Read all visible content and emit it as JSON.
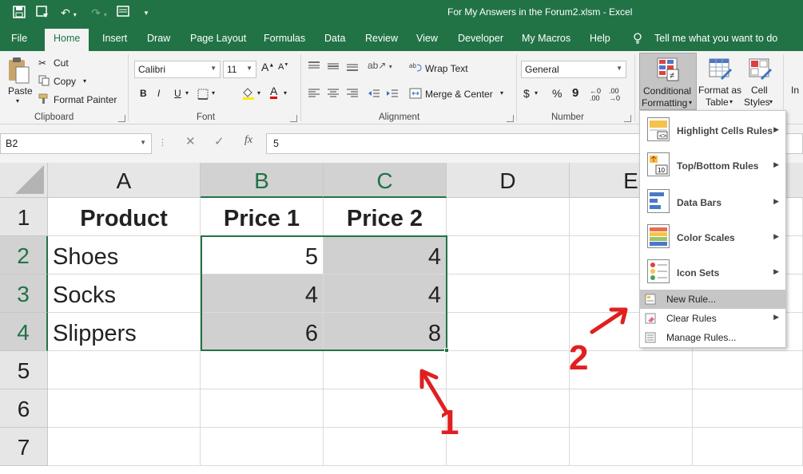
{
  "window": {
    "title": "For My Answers in the Forum2.xlsm  -  Excel"
  },
  "quick_access": {
    "save_icon": "save-icon",
    "autosave_icon": "autosave-icon",
    "undo_icon": "undo-icon",
    "redo_icon": "redo-icon",
    "form_icon": "form-icon",
    "customize_icon": "customize-icon"
  },
  "tabs": [
    {
      "label": "File"
    },
    {
      "label": "Home"
    },
    {
      "label": "Insert"
    },
    {
      "label": "Draw"
    },
    {
      "label": "Page Layout"
    },
    {
      "label": "Formulas"
    },
    {
      "label": "Data"
    },
    {
      "label": "Review"
    },
    {
      "label": "View"
    },
    {
      "label": "Developer"
    },
    {
      "label": "My Macros"
    },
    {
      "label": "Help"
    }
  ],
  "tell_me": "Tell me what you want to do",
  "ribbon": {
    "clipboard": {
      "label": "Clipboard",
      "paste": "Paste",
      "cut": "Cut",
      "copy": "Copy",
      "format_painter": "Format Painter"
    },
    "font": {
      "label": "Font",
      "name": "Calibri",
      "size": "11",
      "bold": "B",
      "italic": "I",
      "underline": "U",
      "font_color_letter": "A"
    },
    "alignment": {
      "label": "Alignment",
      "wrap_text": "Wrap Text",
      "merge_center": "Merge & Center"
    },
    "number": {
      "label": "Number",
      "format": "General",
      "currency": "$",
      "percent": "%",
      "comma": "9"
    },
    "styles": {
      "conditional_formatting": "Conditional",
      "conditional_formatting_2": "Formatting",
      "format_as_table": "Format as",
      "format_as_table_2": "Table",
      "cell_styles": "Cell",
      "cell_styles_2": "Styles",
      "insert_partial": "In"
    }
  },
  "formula_bar": {
    "name_box": "B2",
    "fx": "fx",
    "value": "5"
  },
  "columns": [
    "A",
    "B",
    "C",
    "D",
    "E"
  ],
  "rows": [
    "1",
    "2",
    "3",
    "4",
    "5",
    "6",
    "7"
  ],
  "sheet": {
    "header": [
      "Product",
      "Price 1",
      "Price 2"
    ],
    "data": [
      [
        "Shoes",
        "5",
        "4"
      ],
      [
        "Socks",
        "4",
        "4"
      ],
      [
        "Slippers",
        "6",
        "8"
      ]
    ]
  },
  "cf_menu": {
    "highlight": "Highlight Cells Rules",
    "topbottom": "Top/Bottom Rules",
    "databars": "Data Bars",
    "colorscales": "Color Scales",
    "iconsets": "Icon Sets",
    "new_rule": "New Rule...",
    "clear_rules": "Clear Rules",
    "manage_rules": "Manage Rules..."
  },
  "annotations": {
    "one": "1",
    "two": "2"
  },
  "colors": {
    "excel_green": "#217346",
    "annotation_red": "#e02020",
    "selected_shade": "#d0d0d0"
  }
}
